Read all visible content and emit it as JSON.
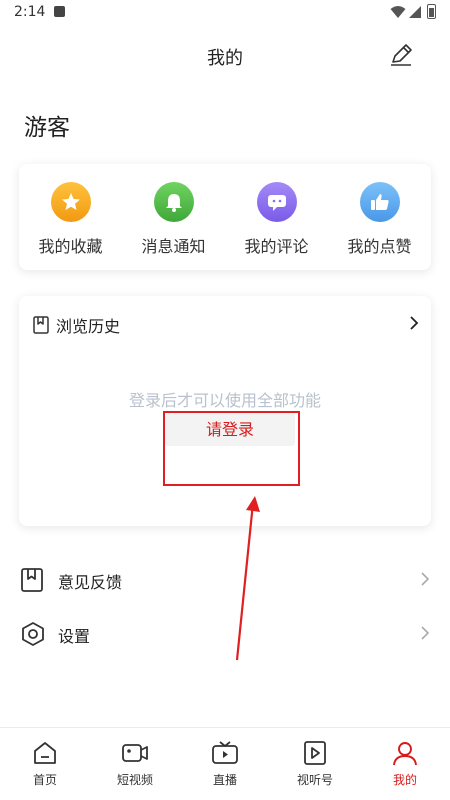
{
  "status_bar": {
    "time": "2:14"
  },
  "header": {
    "title": "我的"
  },
  "user": {
    "name": "游客"
  },
  "quick_actions": [
    {
      "label": "我的收藏",
      "icon": "star-icon",
      "color": "#f5a21b"
    },
    {
      "label": "消息通知",
      "icon": "bell-icon",
      "color": "#4cb944"
    },
    {
      "label": "我的评论",
      "icon": "comment-icon",
      "color": "#8b6cf0"
    },
    {
      "label": "我的点赞",
      "icon": "thumbs-up-icon",
      "color": "#5aaaf0"
    }
  ],
  "history": {
    "title": "浏览历史",
    "hint": "登录后才可以使用全部功能",
    "login_label": "请登录"
  },
  "menu": [
    {
      "label": "意见反馈",
      "icon": "feedback-icon"
    },
    {
      "label": "设置",
      "icon": "settings-icon"
    }
  ],
  "tabs": [
    {
      "label": "首页",
      "icon": "home-icon"
    },
    {
      "label": "短视频",
      "icon": "short-video-icon"
    },
    {
      "label": "直播",
      "icon": "live-tv-icon"
    },
    {
      "label": "视听号",
      "icon": "play-icon"
    },
    {
      "label": "我的",
      "icon": "profile-icon",
      "active": true
    }
  ],
  "colors": {
    "accent": "#d41c1c",
    "highlight": "#e02020"
  }
}
